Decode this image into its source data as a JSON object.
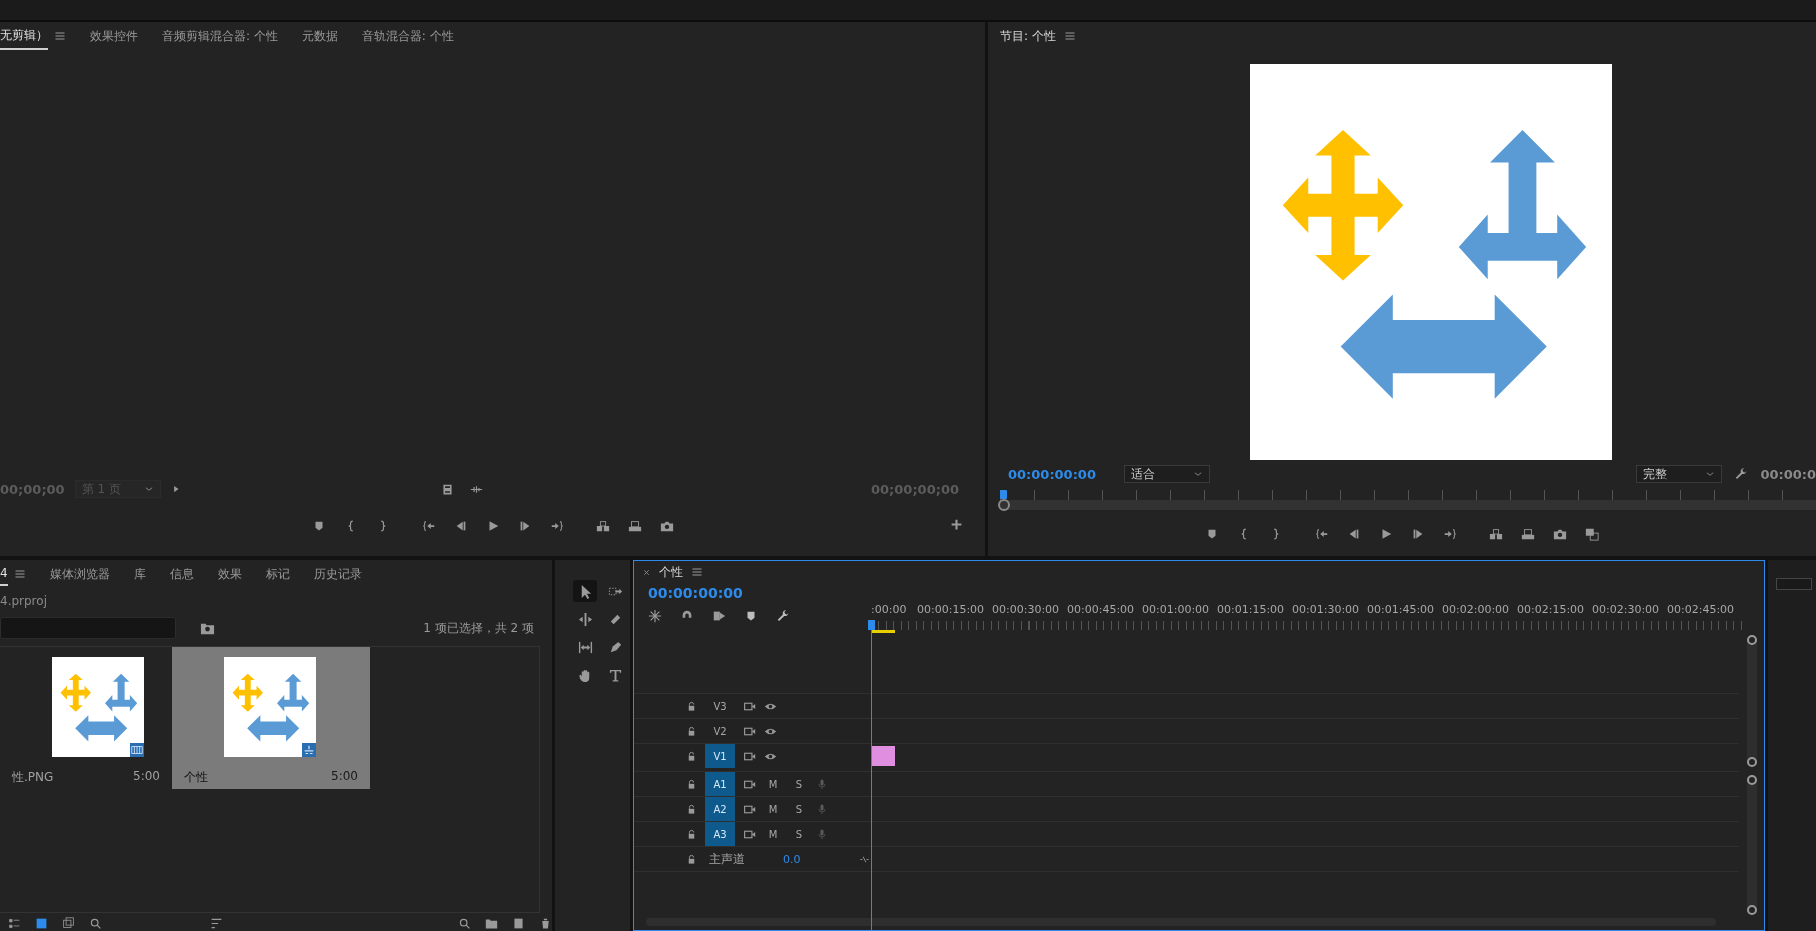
{
  "source_panel": {
    "tabs": [
      {
        "label": "无剪辑）",
        "selected": true
      },
      {
        "label": "效果控件",
        "selected": false
      },
      {
        "label": "音频剪辑混合器: 个性",
        "selected": false
      },
      {
        "label": "元数据",
        "selected": false
      },
      {
        "label": "音轨混合器: 个性",
        "selected": false
      }
    ],
    "timecode_in": "00;00;00",
    "page_dropdown": {
      "value": "第 1 页",
      "disabled": true
    },
    "timecode_out": "00;00;00;00"
  },
  "program_panel": {
    "title": "节目: 个性",
    "timecode": "00:00:00:00",
    "fit_dropdown": "适合",
    "quality_dropdown": "完整",
    "duration": "00:00:0"
  },
  "project_panel": {
    "tabs": [
      {
        "label": "4",
        "selected": true
      },
      {
        "label": "媒体浏览器",
        "selected": false
      },
      {
        "label": "库",
        "selected": false
      },
      {
        "label": "信息",
        "selected": false
      },
      {
        "label": "效果",
        "selected": false
      },
      {
        "label": "标记",
        "selected": false
      },
      {
        "label": "历史记录",
        "selected": false
      }
    ],
    "project_file": "4.prproj",
    "selection_info": "1 项已选择，共 2 项",
    "items": [
      {
        "kind": "still",
        "name": "性.PNG",
        "duration": "5:00",
        "selected": false
      },
      {
        "kind": "sequence",
        "name": "个性",
        "duration": "5:00",
        "selected": true
      }
    ]
  },
  "tools": [
    {
      "kind": "selection",
      "selected": true
    },
    {
      "kind": "track_select",
      "selected": false
    },
    {
      "kind": "ripple",
      "selected": false
    },
    {
      "kind": "razor",
      "selected": false
    },
    {
      "kind": "slip",
      "selected": false
    },
    {
      "kind": "pen",
      "selected": false
    },
    {
      "kind": "hand",
      "selected": false
    },
    {
      "kind": "type",
      "selected": false
    }
  ],
  "timeline": {
    "title": "个性",
    "timecode": "00:00:00:00",
    "ruler_labels": [
      ":00:00",
      "00:00:15:00",
      "00:00:30:00",
      "00:00:45:00",
      "00:01:00:00",
      "00:01:15:00",
      "00:01:30:00",
      "00:01:45:00",
      "00:02:00:00",
      "00:02:15:00",
      "00:02:30:00",
      "00:02:45:00"
    ],
    "tracks": [
      {
        "kind": "video",
        "label": "V3",
        "targeted": false,
        "has_clip": false
      },
      {
        "kind": "video",
        "label": "V2",
        "targeted": false,
        "has_clip": false
      },
      {
        "kind": "video",
        "label": "V1",
        "targeted": true,
        "has_clip": true
      },
      {
        "kind": "audio",
        "label": "A1",
        "targeted": true,
        "mute": "M",
        "solo": "S"
      },
      {
        "kind": "audio",
        "label": "A2",
        "targeted": true,
        "mute": "M",
        "solo": "S"
      },
      {
        "kind": "audio",
        "label": "A3",
        "targeted": true,
        "mute": "M",
        "solo": "S"
      }
    ],
    "master": {
      "label": "主声道",
      "value": "0.0"
    }
  }
}
